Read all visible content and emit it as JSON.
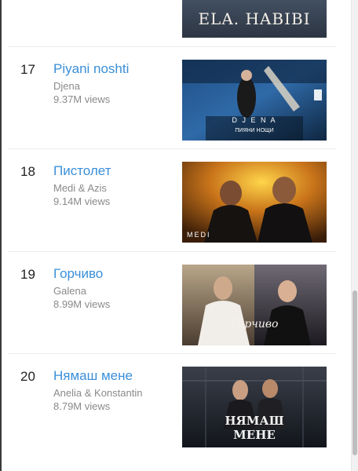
{
  "chart": {
    "partial_thumb_text": "ELA. HABIBI",
    "items": [
      {
        "rank": "17",
        "title": "Piyani noshti",
        "artist": "Djena",
        "views": "9.37M views",
        "thumb_text_1": "D J E N A",
        "thumb_text_2": "ПИЯНИ НОЩИ"
      },
      {
        "rank": "18",
        "title": "Пистолет",
        "artist": "Medi & Azis",
        "views": "9.14M views",
        "thumb_text_1": "MEDI"
      },
      {
        "rank": "19",
        "title": "Горчиво",
        "artist": "Galena",
        "views": "8.99M views",
        "thumb_text_1": "Горчиво"
      },
      {
        "rank": "20",
        "title": "Нямаш мене",
        "artist": "Anelia & Konstantin",
        "views": "8.79M views",
        "thumb_text_1": "НЯМАШ",
        "thumb_text_2": "МЕНЕ"
      }
    ]
  },
  "colors": {
    "title_link": "#3a8fd8",
    "meta_text": "#8a8a8a",
    "rank_text": "#222222"
  }
}
